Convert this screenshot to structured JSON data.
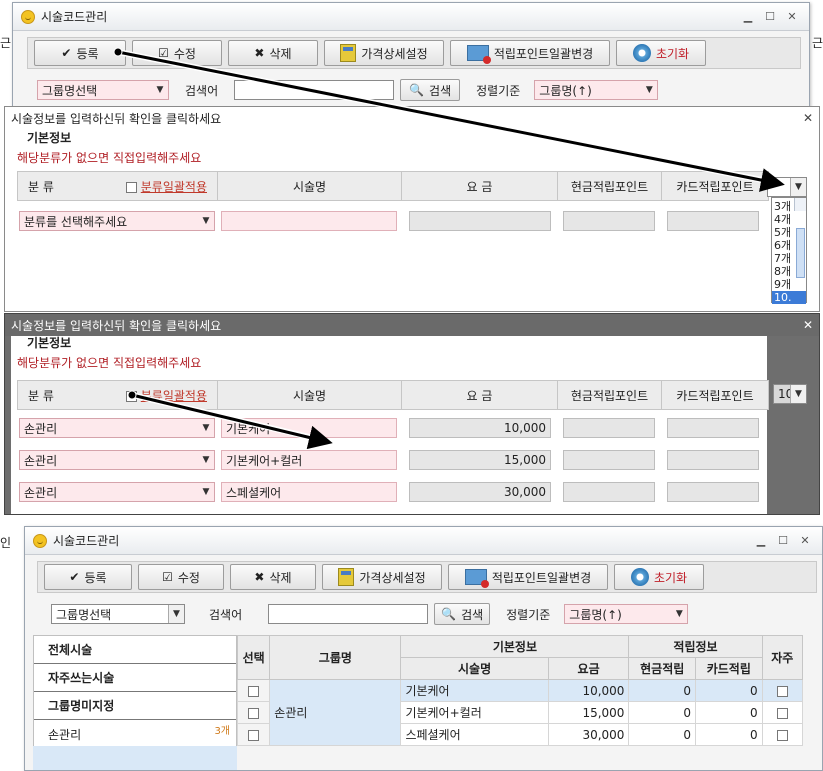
{
  "app": {
    "title": "시술코드관리",
    "edge_fragments": [
      "근",
      "인",
      "근"
    ],
    "toolbar": {
      "register": "등록",
      "edit": "수정",
      "delete": "삭제",
      "price_detail": "가격상세설정",
      "point_bulk": "적립포인트일괄변경",
      "reset": "초기화"
    },
    "search": {
      "group_select": "그룹명선택",
      "search_label": "검색어",
      "search_value": "",
      "search_button": "검색",
      "sort_label": "정렬기준",
      "sort_value": "그룹명(↑)"
    }
  },
  "dialog": {
    "title": "시술정보를 입력하신뒤 확인을 클릭하세요",
    "section": "기본정보",
    "hint": "해당분류가 없으면 직접입력해주세요",
    "headers": {
      "category": "분 류",
      "bulk_apply": "분류일괄적용",
      "name": "시술명",
      "price": "요 금",
      "cash_point": "현금적립포인트",
      "card_point": "카드적립포인트"
    },
    "first_row_placeholder": "분류를 선택해주세요",
    "count_options": [
      "3개",
      "4개",
      "5개",
      "6개",
      "7개",
      "8개",
      "9개",
      "10."
    ],
    "count_selected": "10",
    "rows": [
      {
        "category": "손관리",
        "name": "기본케어",
        "price": "10,000"
      },
      {
        "category": "손관리",
        "name": "기본케어+컬러",
        "price": "15,000"
      },
      {
        "category": "손관리",
        "name": "스페셜케어",
        "price": "30,000"
      }
    ]
  },
  "main": {
    "groups": [
      {
        "label": "전체시술"
      },
      {
        "label": "자주쓰는시술"
      },
      {
        "label": "그룹명미지정"
      },
      {
        "label": "손관리",
        "count": "3개"
      }
    ],
    "table": {
      "h_select": "선택",
      "h_group": "그룹명",
      "h_basic": "기본정보",
      "h_points": "적립정보",
      "h_freq": "자주",
      "h_name": "시술명",
      "h_price": "요금",
      "h_cash": "현금적립",
      "h_card": "카드적립",
      "group_value": "손관리",
      "rows": [
        {
          "name": "기본케어",
          "price": "10,000",
          "cash": "0",
          "card": "0"
        },
        {
          "name": "기본케어+컬러",
          "price": "15,000",
          "cash": "0",
          "card": "0"
        },
        {
          "name": "스페셜케어",
          "price": "30,000",
          "cash": "0",
          "card": "0"
        }
      ]
    }
  }
}
